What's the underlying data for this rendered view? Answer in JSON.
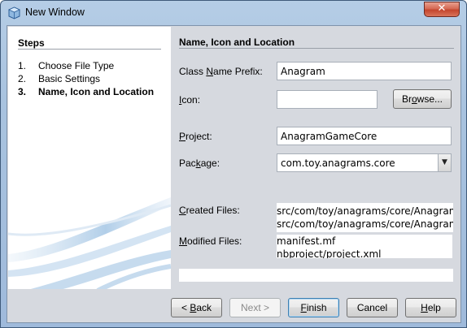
{
  "window": {
    "title": "New Window",
    "close_glyph": "✕"
  },
  "steps": {
    "title": "Steps",
    "items": [
      {
        "num": "1.",
        "label": "Choose File Type"
      },
      {
        "num": "2.",
        "label": "Basic Settings"
      },
      {
        "num": "3.",
        "label": "Name, Icon and Location"
      }
    ]
  },
  "content": {
    "title": "Name, Icon and Location",
    "class_prefix": {
      "label_pre": "Class ",
      "label_key": "N",
      "label_post": "ame Prefix:",
      "value": "Anagram"
    },
    "icon": {
      "label_pre": "",
      "label_key": "I",
      "label_post": "con:",
      "value": ""
    },
    "browse_button": {
      "pre": "Br",
      "key": "o",
      "post": "wse..."
    },
    "project": {
      "label_pre": "",
      "label_key": "P",
      "label_post": "roject:",
      "value": "AnagramGameCore"
    },
    "package": {
      "label_pre": "Pac",
      "label_key": "k",
      "label_post": "age:",
      "value": "com.toy.anagrams.core",
      "arrow": "▼"
    },
    "created_files": {
      "label_pre": "",
      "label_key": "C",
      "label_post": "reated Files:",
      "lines": [
        "src/com/toy/anagrams/core/AnagramTopComponent.java",
        "src/com/toy/anagrams/core/AnagramTopComponent.form"
      ]
    },
    "modified_files": {
      "label_pre": "",
      "label_key": "M",
      "label_post": "odified Files:",
      "lines": [
        "manifest.mf",
        "nbproject/project.xml"
      ]
    }
  },
  "footer": {
    "back": {
      "pre": "< ",
      "key": "B",
      "post": "ack"
    },
    "next": "Next >",
    "finish": {
      "pre": "",
      "key": "F",
      "post": "inish"
    },
    "cancel": "Cancel",
    "help": {
      "pre": "",
      "key": "H",
      "post": "elp"
    }
  },
  "colors": {
    "title_bar": "#b5cde6",
    "close_button": "#c4452d",
    "dialog_bg": "#d6d9df"
  }
}
